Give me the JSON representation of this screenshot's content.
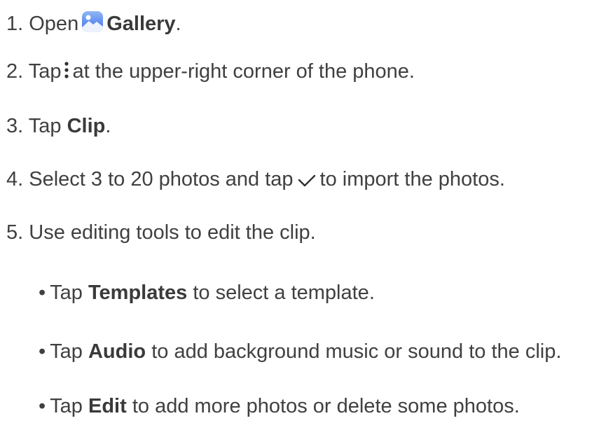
{
  "steps": [
    {
      "number": "1.",
      "before": "Open",
      "bold": "Gallery",
      "after": ".",
      "icon": "gallery-icon"
    },
    {
      "number": "2.",
      "before": "Tap",
      "after": "at the upper-right corner of the phone.",
      "icon": "more-vertical-icon"
    },
    {
      "number": "3.",
      "before": "Tap",
      "bold": "Clip",
      "after": "."
    },
    {
      "number": "4.",
      "before": "Select 3 to 20 photos and tap",
      "after": "to import the photos.",
      "icon": "checkmark-icon"
    },
    {
      "number": "5.",
      "text": "Use editing tools to edit the clip."
    }
  ],
  "substeps": [
    {
      "bullet": "•",
      "before": "Tap",
      "bold": "Templates",
      "after": "to select a template."
    },
    {
      "bullet": "•",
      "before": "Tap",
      "bold": "Audio",
      "after": "to add background music or sound to the clip."
    },
    {
      "bullet": "•",
      "before": "Tap",
      "bold": "Edit",
      "after": "to add more photos or delete some photos."
    }
  ],
  "colors": {
    "text": "#404040",
    "gallery_icon_top": "#7aa7f5",
    "gallery_icon_bottom": "#3d6ee8"
  }
}
